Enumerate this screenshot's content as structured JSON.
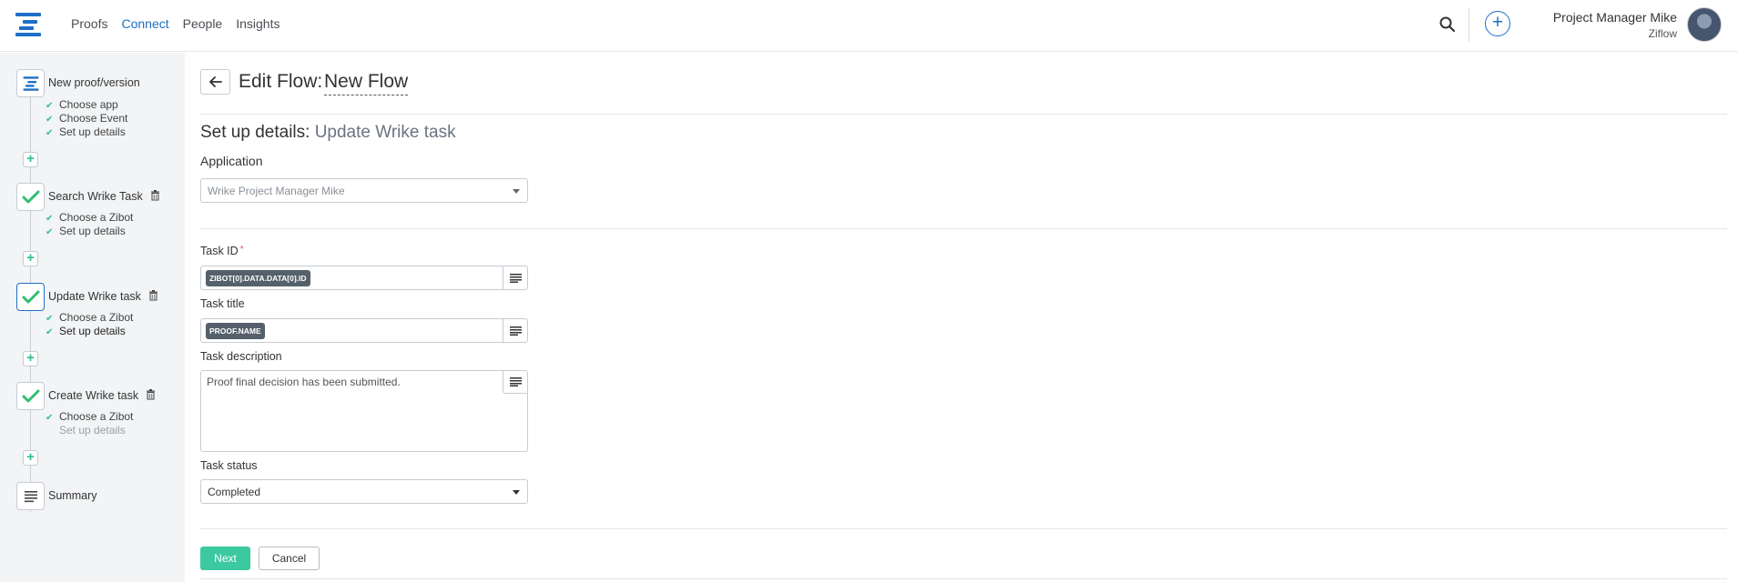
{
  "colors": {
    "brand": "#1f6fc6",
    "accent_green": "#3cc9a0",
    "chip_bg": "#55606b",
    "sidebar_bg": "#f2f4f6"
  },
  "nav": {
    "items": [
      {
        "label": "Proofs",
        "active": false
      },
      {
        "label": "Connect",
        "active": true
      },
      {
        "label": "People",
        "active": false
      },
      {
        "label": "Insights",
        "active": false
      }
    ]
  },
  "user": {
    "name": "Project Manager Mike",
    "org": "Ziflow"
  },
  "sidebar": {
    "steps": [
      {
        "title": "New proof/version",
        "icon": "ziflow-logo-icon",
        "substeps": [
          {
            "label": "Choose app",
            "checked": true
          },
          {
            "label": "Choose Event",
            "checked": true
          },
          {
            "label": "Set up details",
            "checked": true
          }
        ]
      },
      {
        "title": "Search Wrike Task",
        "icon": "checkmark-icon",
        "deletable": true,
        "substeps": [
          {
            "label": "Choose a Zibot",
            "checked": true
          },
          {
            "label": "Set up details",
            "checked": true
          }
        ]
      },
      {
        "title": "Update Wrike task",
        "icon": "checkmark-icon",
        "deletable": true,
        "current": true,
        "substeps": [
          {
            "label": "Choose a Zibot",
            "checked": true
          },
          {
            "label": "Set up details",
            "checked": true,
            "active": true
          }
        ]
      },
      {
        "title": "Create Wrike task",
        "icon": "checkmark-icon",
        "deletable": true,
        "substeps": [
          {
            "label": "Choose a Zibot",
            "checked": true
          },
          {
            "label": "Set up details",
            "checked": false
          }
        ]
      },
      {
        "title": "Summary",
        "icon": "list-lines-icon"
      }
    ]
  },
  "header": {
    "edit_flow_label": "Edit Flow:",
    "flow_name": "New Flow"
  },
  "form": {
    "setup_prefix": "Set up details:",
    "setup_subject": "Update Wrike task",
    "application_label": "Application",
    "application_value": "Wrike Project Manager Mike",
    "task_id_label": "Task ID",
    "task_id_required": "*",
    "task_id_chip": "ZIBOT[0].DATA.DATA[0].ID",
    "task_title_label": "Task title",
    "task_title_chip": "PROOF.NAME",
    "task_description_label": "Task description",
    "task_description_value": "Proof final decision has been submitted.",
    "task_status_label": "Task status",
    "task_status_value": "Completed"
  },
  "actions": {
    "next_label": "Next",
    "cancel_label": "Cancel"
  }
}
